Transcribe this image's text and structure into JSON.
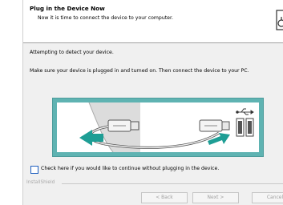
{
  "header": {
    "title": "Plug in the Device Now",
    "subtitle": "Now it is time to connect the device to your computer."
  },
  "body": {
    "line1": "Attempting to detect your device.",
    "line2": "Make sure your device is plugged in and turned on.  Then connect the device to your PC."
  },
  "checkbox": {
    "label": "Check here if you would like to continue without plugging in the device.",
    "checked": false
  },
  "footer": {
    "brand": "InstallShield",
    "buttons": {
      "back": "< Back",
      "next": "Next >",
      "cancel": "Cancel"
    }
  },
  "colors": {
    "illustration_frame": "#5fb3b2",
    "checkbox_border": "#1f5fbf"
  },
  "icons": [
    "device-plug-icon",
    "usb-symbol-icon",
    "usb-ports-icon",
    "arrow-icon"
  ]
}
